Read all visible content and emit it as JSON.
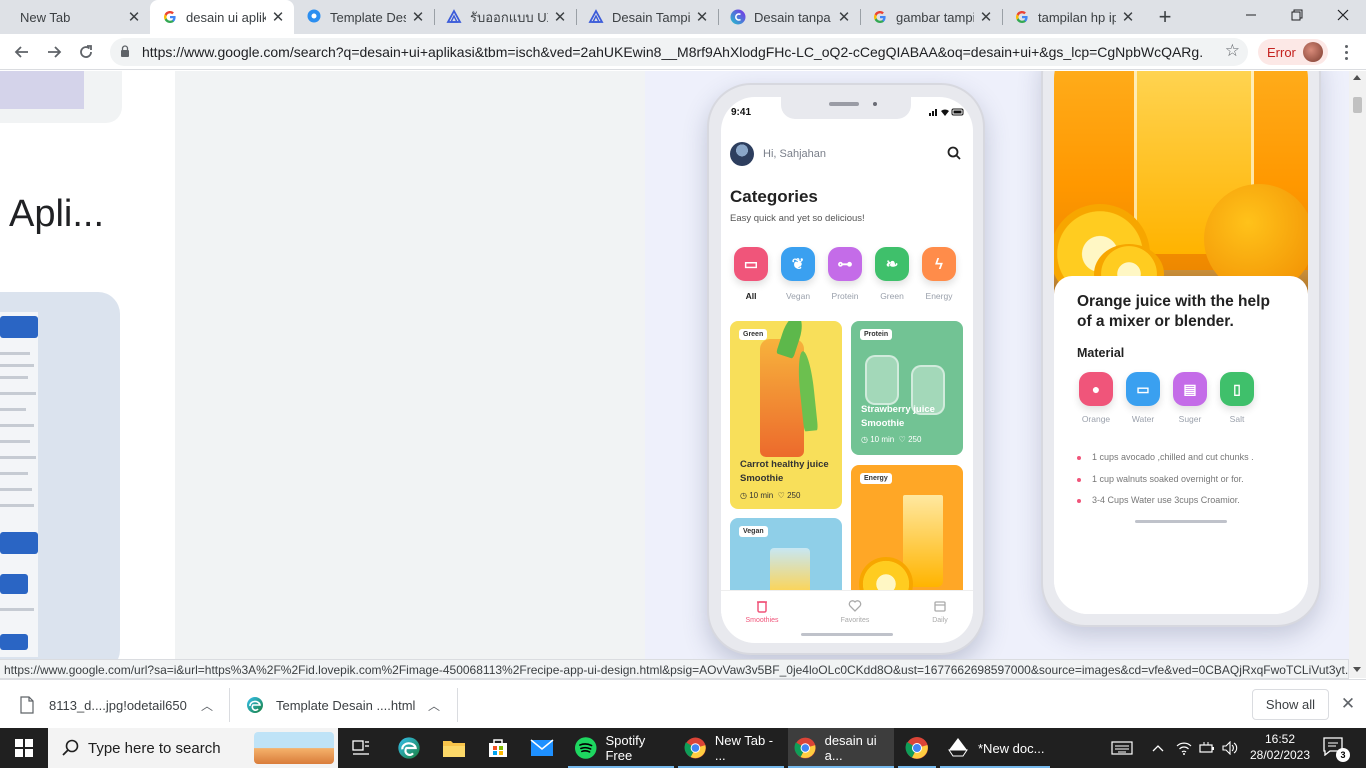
{
  "browser": {
    "tabs": [
      {
        "label": "New Tab",
        "icon": "none",
        "active": false
      },
      {
        "label": "desain ui aplik",
        "icon": "google-g-icon",
        "active": true
      },
      {
        "label": "Template Desa",
        "icon": "speech-bubble-icon",
        "active": false
      },
      {
        "label": "รับออกแบบ UX, U",
        "icon": "triangle-logo-icon",
        "active": false
      },
      {
        "label": "Desain Tampila",
        "icon": "triangle-logo-icon",
        "active": false
      },
      {
        "label": "Desain tanpa ju",
        "icon": "canva-icon",
        "active": false
      },
      {
        "label": "gambar tampil",
        "icon": "google-g-icon",
        "active": false
      },
      {
        "label": "tampilan hp ip",
        "icon": "google-g-icon",
        "active": false
      }
    ],
    "url": "https://www.google.com/search?q=desain+ui+aplikasi&tbm=isch&ved=2ahUKEwin8__M8rf9AhXlodgFHc-LC_oQ2-cCegQIABAA&oq=desain+ui+&gs_lcp=CgNpbWcQARg...",
    "profile_status": "Error",
    "status_url": "https://www.google.com/url?sa=i&url=https%3A%2F%2Fid.lovepik.com%2Fimage-450068113%2Frecipe-app-ui-design.html&psig=AOvVaw3v5BF_0je4loOLc0CKdd8O&ust=1677662698597000&source=images&cd=vfe&ved=0CBAQjRxqFwoTCLiVut3yt..."
  },
  "page": {
    "left_title": "Apli..."
  },
  "phone1": {
    "time": "9:41",
    "greeting": "Hi, Sahjahan",
    "title": "Categories",
    "subtitle": "Easy quick and yet so delicious!",
    "categories": [
      {
        "label": "All",
        "color": "#f0557a"
      },
      {
        "label": "Vegan",
        "color": "#3aa0f0"
      },
      {
        "label": "Protein",
        "color": "#c46ce8"
      },
      {
        "label": "Green",
        "color": "#3fc06b"
      },
      {
        "label": "Energy",
        "color": "#ff8c4a"
      }
    ],
    "recipes": [
      {
        "tag": "Green",
        "name": "Carrot healthy juice Smoothie",
        "time": "10 min",
        "likes": "250"
      },
      {
        "tag": "Protein",
        "name": "Strawberry juice Smoothie",
        "time": "10 min",
        "likes": "250"
      },
      {
        "tag": "Energy"
      },
      {
        "tag": "Vegan"
      }
    ],
    "tabbar": [
      {
        "label": "Smoothies"
      },
      {
        "label": "Favorites"
      },
      {
        "label": "Daily"
      }
    ]
  },
  "phone2": {
    "title": "Orange juice with the help of a mixer or blender.",
    "material_title": "Material",
    "materials": [
      {
        "label": "Orange",
        "color": "#f0557a"
      },
      {
        "label": "Water",
        "color": "#3aa0f0"
      },
      {
        "label": "Suger",
        "color": "#c46ce8"
      },
      {
        "label": "Salt",
        "color": "#3fc06b"
      }
    ],
    "ingredients": [
      "1 cups avocado ,chilled and cut chunks .",
      "1 cup walnuts soaked overnight or for.",
      "3-4 Cups Water use 3cups Croamior."
    ]
  },
  "downloads": {
    "items": [
      {
        "label": "8113_d....jpg!odetail650"
      },
      {
        "label": "Template Desain ....html"
      }
    ],
    "show_all": "Show all"
  },
  "taskbar": {
    "search_placeholder": "Type here to search",
    "apps": [
      {
        "label": "Spotify Free"
      },
      {
        "label": "New Tab - ..."
      },
      {
        "label": "desain ui a..."
      },
      {
        "label": ""
      },
      {
        "label": "*New doc..."
      }
    ],
    "time": "16:52",
    "date": "28/02/2023",
    "notifications": "3"
  }
}
